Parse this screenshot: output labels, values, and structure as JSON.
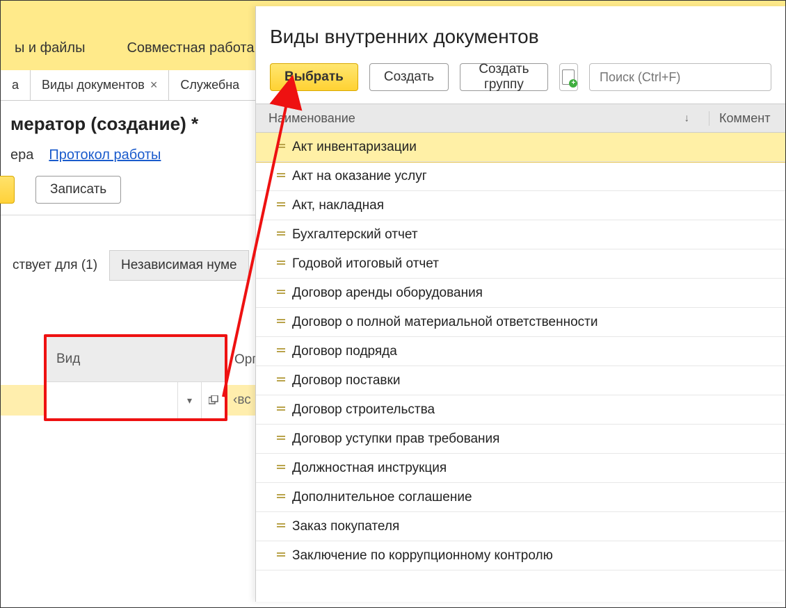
{
  "ribbon": {
    "item_files": "ы и файлы",
    "item_collab": "Совместная работа"
  },
  "tabs": {
    "first": "а",
    "docs": "Виды документов",
    "svc": "Служебна"
  },
  "page": {
    "title": "мератор (создание) *",
    "link_era": "ера",
    "link_protocol": "Протокол работы",
    "btn_write": "Записать",
    "subtab_active": "ствует для (1)",
    "subtab_indep": "Независимая нуме"
  },
  "field": {
    "label_vid": "Вид",
    "label_org": "Орг",
    "val_all": "‹вс"
  },
  "popup": {
    "title": "Виды внутренних документов",
    "btn_select": "Выбрать",
    "btn_create": "Создать",
    "btn_create_group": "Создать группу",
    "search_placeholder": "Поиск (Ctrl+F)",
    "col_name": "Наименование",
    "col_comment": "Коммент",
    "rows": {
      "r0": "Акт инвентаризации",
      "r1": "Акт на оказание услуг",
      "r2": "Акт, накладная",
      "r3": "Бухгалтерский отчет",
      "r4": "Годовой итоговый отчет",
      "r5": "Договор аренды оборудования",
      "r6": "Договор о полной материальной ответственности",
      "r7": "Договор подряда",
      "r8": "Договор поставки",
      "r9": "Договор строительства",
      "r10": "Договор уступки прав требования",
      "r11": "Должностная инструкция",
      "r12": "Дополнительное соглашение",
      "r13": "Заказ покупателя",
      "r14": "Заключение по коррупционному контролю"
    }
  }
}
